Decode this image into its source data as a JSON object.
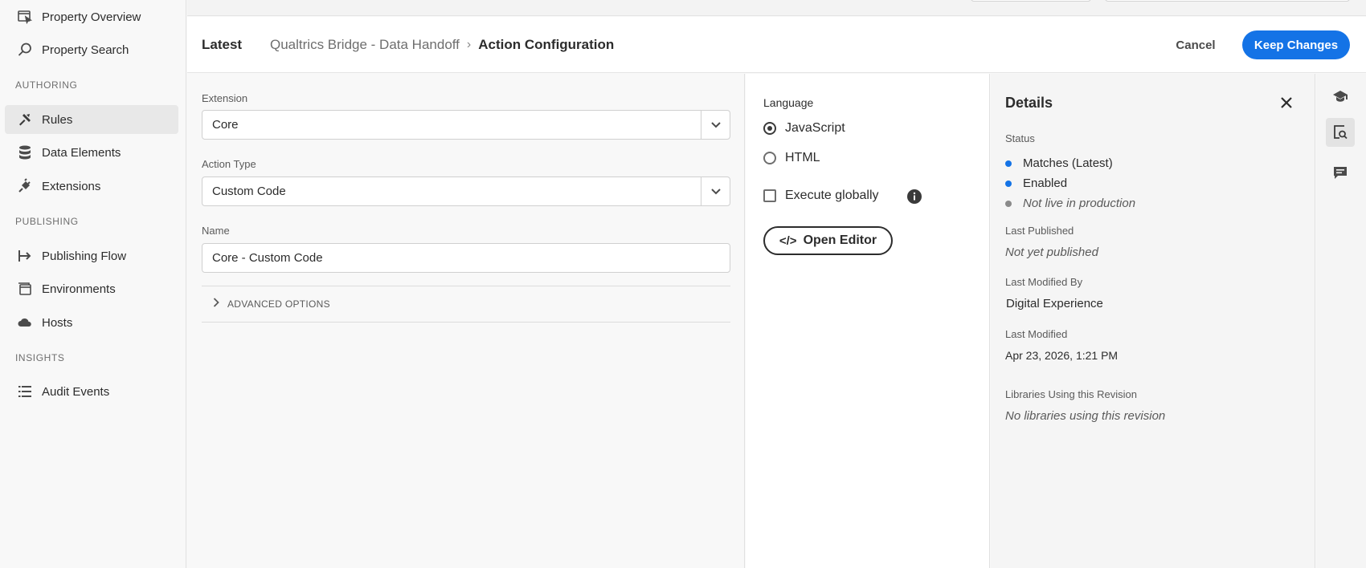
{
  "sidebar": {
    "items": [
      {
        "label": "Property Overview",
        "icon": "property-overview-icon"
      },
      {
        "label": "Property Search",
        "icon": "search-icon"
      },
      {
        "label": "Rules",
        "icon": "rules-icon"
      },
      {
        "label": "Data Elements",
        "icon": "database-icon"
      },
      {
        "label": "Extensions",
        "icon": "plug-icon"
      },
      {
        "label": "Publishing Flow",
        "icon": "publishing-flow-icon"
      },
      {
        "label": "Environments",
        "icon": "environments-icon"
      },
      {
        "label": "Hosts",
        "icon": "cloud-icon"
      },
      {
        "label": "Audit Events",
        "icon": "list-icon"
      }
    ],
    "sections": {
      "authoring": "AUTHORING",
      "publishing": "PUBLISHING",
      "insights": "INSIGHTS"
    },
    "active": "Rules"
  },
  "header": {
    "latest": "Latest",
    "breadcrumb": [
      "Qualtrics Bridge - Data Handoff",
      "Action Configuration"
    ],
    "cancel_label": "Cancel",
    "keep_label": "Keep Changes"
  },
  "form": {
    "extension_label": "Extension",
    "extension_value": "Core",
    "action_type_label": "Action Type",
    "action_type_value": "Custom Code",
    "name_label": "Name",
    "name_value": "Core - Custom Code",
    "advanced_label": "ADVANCED OPTIONS"
  },
  "config": {
    "language_label": "Language",
    "languages": [
      "JavaScript",
      "HTML"
    ],
    "selected_language": "JavaScript",
    "execute_globally_label": "Execute globally",
    "execute_globally_checked": false,
    "open_editor_label": "Open Editor",
    "open_editor_glyph": "</>"
  },
  "details": {
    "title": "Details",
    "status_label": "Status",
    "statuses": [
      {
        "text": "Matches (Latest)",
        "color": "#1473e6",
        "italic": false
      },
      {
        "text": "Enabled",
        "color": "#1473e6",
        "italic": false
      },
      {
        "text": "Not live in production",
        "color": "#8a8a8a",
        "italic": true
      }
    ],
    "last_published_label": "Last Published",
    "last_published_value": "Not yet published",
    "last_modified_by_label": "Last Modified By",
    "last_modified_by_value": "Digital Experience",
    "last_modified_label": "Last Modified",
    "last_modified_value": "Apr 23, 2026, 1:21 PM",
    "libraries_label": "Libraries Using this Revision",
    "libraries_value": "No libraries using this revision"
  },
  "colors": {
    "accent": "#1473e6",
    "muted_dot": "#8a8a8a"
  }
}
